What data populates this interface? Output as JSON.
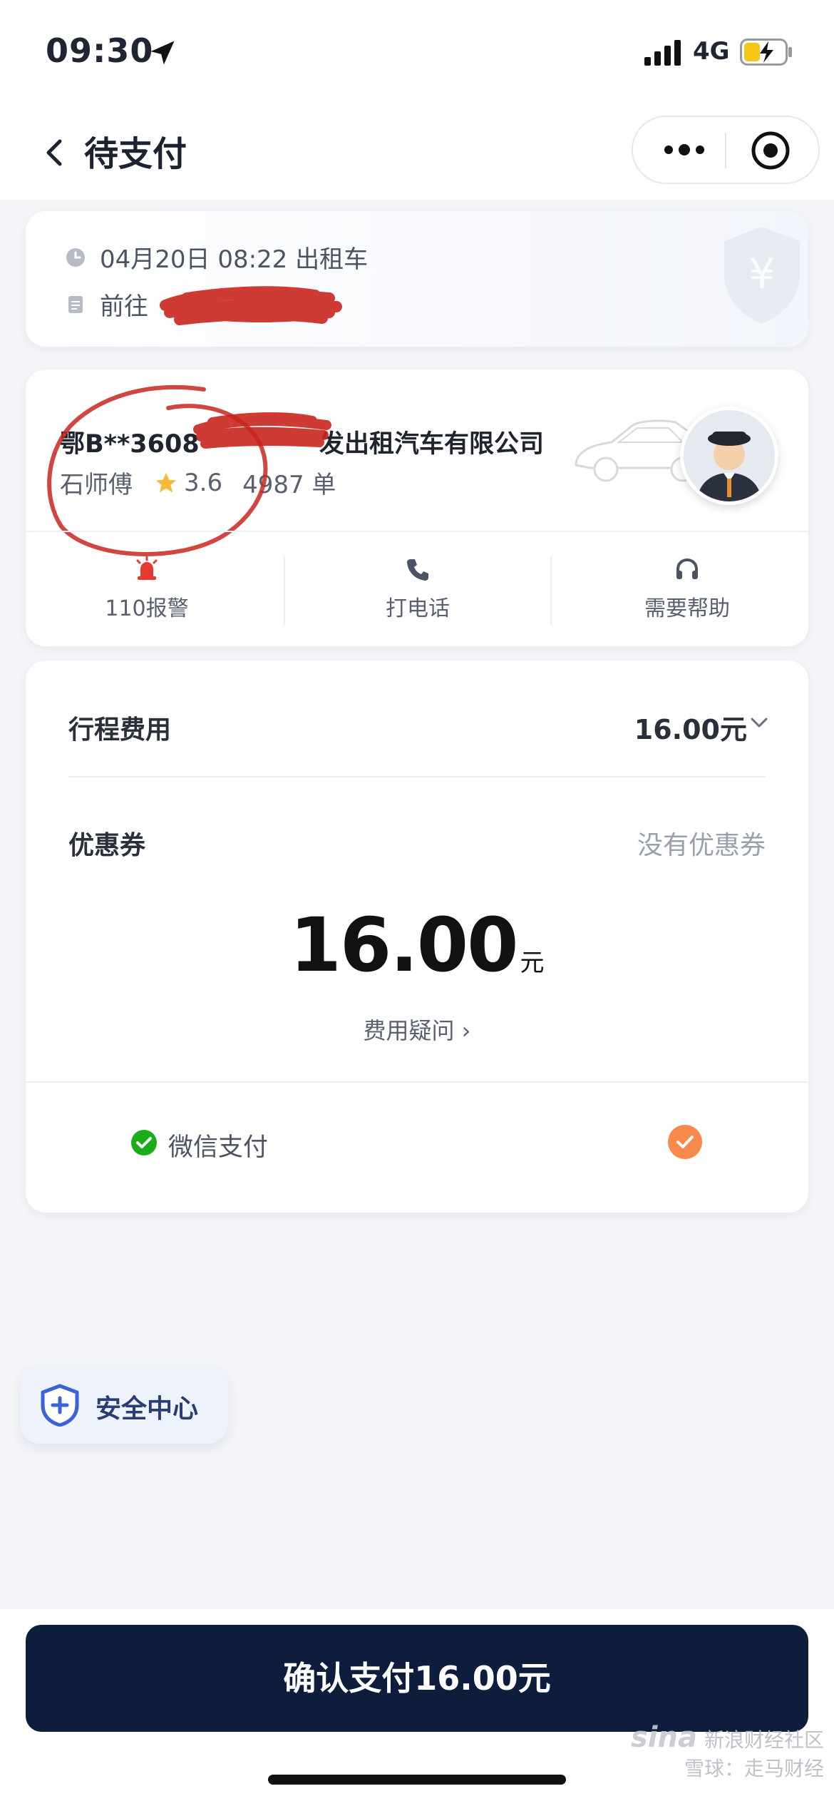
{
  "status_bar": {
    "time": "09:30",
    "network": "4G"
  },
  "nav": {
    "title": "待支付"
  },
  "trip": {
    "datetime_type": "04月20日 08:22 出租车",
    "destination_prefix": "前往"
  },
  "driver": {
    "plate": "鄂B**3608",
    "company_suffix": "发出租汽车有限公司",
    "name": "石师傅",
    "rating": "3.6",
    "orders": "4987 单",
    "actions": [
      {
        "label": "110报警"
      },
      {
        "label": "打电话"
      },
      {
        "label": "需要帮助"
      }
    ]
  },
  "payment": {
    "trip_fee_label": "行程费用",
    "trip_fee_value": "16.00元",
    "coupon_label": "优惠券",
    "coupon_value": "没有优惠券",
    "total_amount": "16.00",
    "total_unit": "元",
    "fee_question": "费用疑问 ›",
    "method_label": "微信支付"
  },
  "safety_center": {
    "label": "安全中心"
  },
  "confirm_button": {
    "label": "确认支付16.00元"
  },
  "watermark": {
    "line1": "新浪财经社区",
    "line2": "雪球：走马财经",
    "logo": "sina"
  },
  "colors": {
    "primary_button": "#0f1d3d",
    "accent_orange": "#f7894a",
    "wechat_green": "#1aad19",
    "alert_red": "#e53a2f",
    "scribble_red": "#c8261e"
  }
}
